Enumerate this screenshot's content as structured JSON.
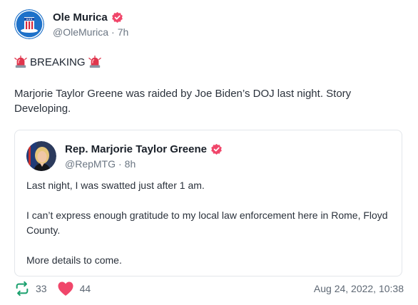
{
  "post": {
    "author": {
      "name": "Ole Murica",
      "handle": "@OleMurica",
      "time": "7h",
      "separator": "·"
    },
    "breaking_label": "BREAKING",
    "text": "Marjorie Taylor Greene was raided by Joe Biden’s DOJ last night. Story Developing."
  },
  "quoted": {
    "author": {
      "name": "Rep. Marjorie Taylor Greene",
      "handle": "@RepMTG",
      "time": "8h",
      "separator": "·"
    },
    "paragraphs": [
      "Last night, I was swatted just after 1 am.",
      "I can’t express enough gratitude to my local law enforcement here in Rome, Floyd County.",
      "More details to come."
    ]
  },
  "footer": {
    "retweets": "33",
    "likes": "44",
    "timestamp": "Aug 24, 2022, 10:38"
  },
  "colors": {
    "verified": "#f0466a",
    "retweet": "#1aa06d",
    "like": "#f0466a",
    "siren": "#e0364d"
  },
  "icons": {
    "verified": "verified-badge-icon",
    "siren": "siren-icon",
    "retweet": "retweet-icon",
    "like": "heart-icon"
  }
}
